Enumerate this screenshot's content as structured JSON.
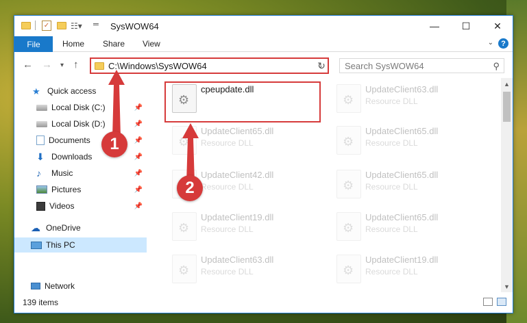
{
  "window": {
    "title": "SysWOW64",
    "controls": {
      "minimize": "—",
      "maximize": "☐",
      "close": "✕"
    }
  },
  "ribbon": {
    "tabs": [
      "File",
      "Home",
      "Share",
      "View"
    ],
    "help": "?"
  },
  "nav": {
    "address": "C:\\Windows\\SysWOW64",
    "search_placeholder": "Search SysWOW64"
  },
  "sidebar": {
    "items": [
      {
        "label": "Quick access",
        "icon": "star-icon"
      },
      {
        "label": "Local Disk (C:)",
        "icon": "drive-icon",
        "pinned": true
      },
      {
        "label": "Local Disk (D:)",
        "icon": "drive-icon",
        "pinned": true
      },
      {
        "label": "Documents",
        "icon": "documents-icon",
        "pinned": true
      },
      {
        "label": "Downloads",
        "icon": "download-icon",
        "pinned": true
      },
      {
        "label": "Music",
        "icon": "music-icon",
        "pinned": true
      },
      {
        "label": "Pictures",
        "icon": "pictures-icon",
        "pinned": true
      },
      {
        "label": "Videos",
        "icon": "videos-icon",
        "pinned": true
      },
      {
        "label": "OneDrive",
        "icon": "cloud-icon"
      },
      {
        "label": "This PC",
        "icon": "computer-icon",
        "selected": true
      },
      {
        "label": "Network",
        "icon": "network-icon"
      }
    ]
  },
  "files": [
    {
      "name": "cpeupdate.dll",
      "type": ""
    },
    {
      "name": "UpdateClient63.dll",
      "type": "Resource DLL"
    },
    {
      "name": "UpdateClient65.dll",
      "type": "Resource DLL"
    },
    {
      "name": "UpdateClient65.dll",
      "type": "Resource DLL"
    },
    {
      "name": "UpdateClient42.dll",
      "type": "Resource DLL"
    },
    {
      "name": "UpdateClient65.dll",
      "type": "Resource DLL"
    },
    {
      "name": "UpdateClient19.dll",
      "type": "Resource DLL"
    },
    {
      "name": "UpdateClient65.dll",
      "type": "Resource DLL"
    },
    {
      "name": "UpdateClient63.dll",
      "type": "Resource DLL"
    },
    {
      "name": "UpdateClient19.dll",
      "type": "Resource DLL"
    }
  ],
  "status": {
    "item_count": "139 items"
  },
  "callouts": {
    "step1": "1",
    "step2": "2"
  },
  "colors": {
    "accent": "#1979ca",
    "highlight": "#d63a3a",
    "selected": "#cce8ff"
  }
}
